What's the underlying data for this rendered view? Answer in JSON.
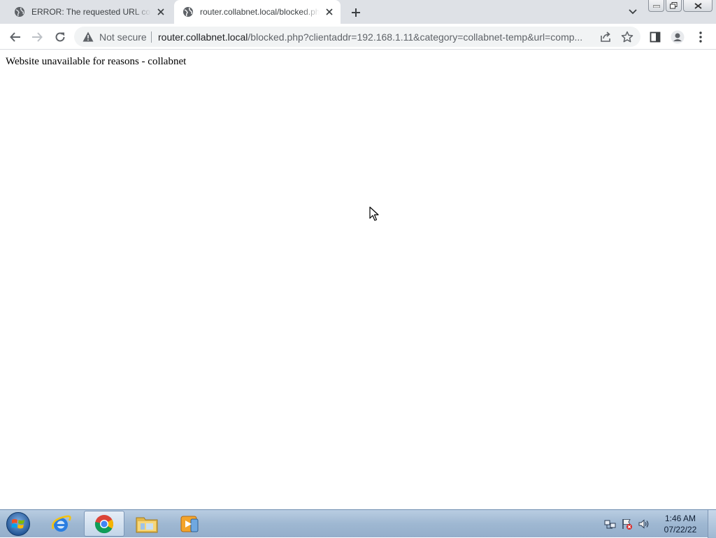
{
  "browser": {
    "tabs": [
      {
        "title": "ERROR: The requested URL could not be retrieved",
        "active": false,
        "favicon": "globe-icon"
      },
      {
        "title": "router.collabnet.local/blocked.php",
        "active": true,
        "favicon": "globe-icon"
      }
    ],
    "omnibox": {
      "security_label": "Not secure",
      "url_host": "router.collabnet.local",
      "url_rest": "/blocked.php?clientaddr=192.168.1.11&category=collabnet-temp&url=comp..."
    }
  },
  "page": {
    "message": "Website unavailable for reasons - collabnet"
  },
  "taskbar": {
    "pinned": [
      "internet-explorer-icon",
      "chrome-icon",
      "file-explorer-icon",
      "media-player-icon"
    ],
    "active_app": "chrome-icon",
    "clock": {
      "time": "1:46 AM",
      "date": "07/22/22"
    }
  },
  "colors": {
    "tabstrip_bg": "#dee1e6",
    "omnibox_bg": "#f1f3f4",
    "taskbar_bg": "#a6bdd6"
  }
}
